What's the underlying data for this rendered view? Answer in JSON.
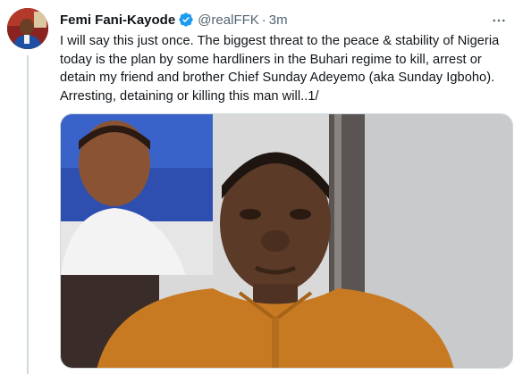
{
  "tweet": {
    "author_name": "Femi Fani-Kayode",
    "handle": "@realFFK",
    "separator": "·",
    "time": "3m",
    "text": "I will say this just once. The biggest threat to the peace & stability of Nigeria today is the plan by some hardliners in the Buhari regime to kill, arrest or detain my friend and brother Chief Sunday Adeyemo (aka Sunday Igboho). Arresting, detaining or killing this man will..1/",
    "verified": true,
    "icons": {
      "verified": "verified-badge-icon",
      "more": "more-options-icon"
    },
    "colors": {
      "verified": "#1d9bf0",
      "secondary_text": "#536471",
      "thread_line": "#cfd9de"
    }
  }
}
